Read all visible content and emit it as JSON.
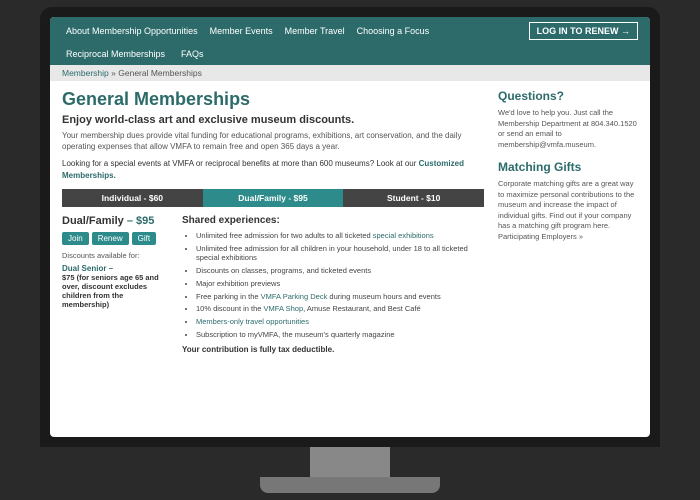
{
  "nav": {
    "links": [
      "About Membership Opportunities",
      "Member Events",
      "Member Travel",
      "Choosing a Focus",
      "Reciprocal Memberships",
      "FAQs"
    ],
    "login_btn": "LOG IN TO RENEW →"
  },
  "breadcrumb": {
    "text": "Membership » General Memberships",
    "membership_link": "Membership",
    "page_link": "General Memberships"
  },
  "page": {
    "title": "General Memberships",
    "subtitle": "Enjoy world-class art and exclusive museum discounts.",
    "description": "Your membership dues provide vital funding for educational programs, exhibitions, art conservation, and the daily operating expenses that allow VMFA to remain free and open 365 days a year.",
    "special_note_prefix": "Looking for a special events at VMFA or reciprocal benefits at more than 600 museums? Look at our ",
    "special_note_link": "Customized Memberships.",
    "tabs": [
      {
        "label": "Individual - $60",
        "type": "individual"
      },
      {
        "label": "Dual/Family - $95",
        "type": "dual",
        "active": true
      },
      {
        "label": "Student - $10",
        "type": "student"
      }
    ],
    "membership_card": {
      "title": "Dual/Family",
      "price": "– $95",
      "btn_join": "Join",
      "btn_renew": "Renew",
      "btn_gift": "Gift",
      "discounts_label": "Discounts available for:",
      "discount_name": "Dual Senior –",
      "discount_desc": "$75 (for seniors age 65 and over, discount excludes children from the membership)"
    },
    "shared": {
      "title": "Shared experiences:",
      "items": [
        "Unlimited free admission for two adults to all ticketed special exhibitions",
        "Unlimited free admission for all children in your household, under 18 to all ticketed special exhibitions",
        "Discounts on classes, programs, and ticketed events",
        "Major exhibition previews",
        "Free parking in the VMFA Parking Deck during museum hours and events",
        "10% discount in the VMFA Shop, Amuse Restaurant, and Best Café",
        "Members-only travel opportunities",
        "Subscription to myVMFA, the museum's quarterly magazine"
      ],
      "tax_note": "Your contribution is fully tax deductible."
    }
  },
  "sidebar": {
    "questions_title": "Questions?",
    "questions_text": "We'd love to help you. Just call the Membership Department at 804.340.1520 or send an email to membership@vmfa.museum.",
    "matching_title": "Matching Gifts",
    "matching_text": "Corporate matching gifts are a great way to maximize personal contributions to the museum and increase the impact of individual gifts. Find out if your company has a matching gift program here. Participating Employers »"
  }
}
